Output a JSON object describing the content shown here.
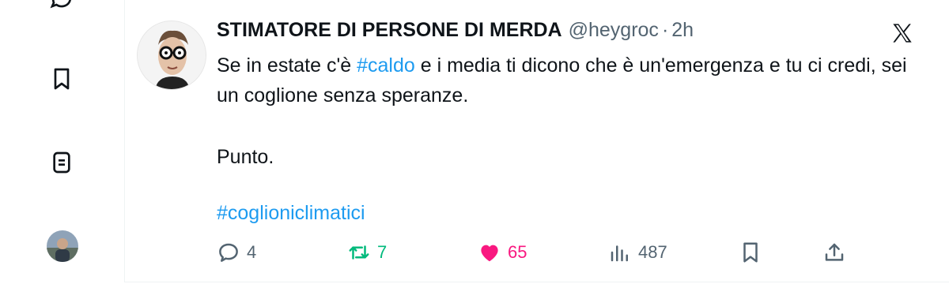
{
  "tweet": {
    "display_name": "STIMATORE DI PERSONE DI MERDA",
    "handle": "@heygroc",
    "separator": "·",
    "time": "2h",
    "text_before": "Se in estate c'è ",
    "hashtag_1": "#caldo",
    "text_after": " e i media ti dicono che è un'emergenza e tu ci credi, sei un coglione senza speranze.",
    "paragraph_2": "Punto.",
    "hashtag_2": "#coglioniclimatici"
  },
  "actions": {
    "replies": "4",
    "retweets": "7",
    "likes": "65",
    "views": "487"
  },
  "colors": {
    "link": "#1d9bf0",
    "retweet": "#00ba7c",
    "like": "#f91880",
    "muted": "#536471"
  },
  "icons": [
    "messages-icon",
    "bookmarks-icon",
    "lists-icon",
    "profile-avatar",
    "x-logo-icon",
    "reply-icon",
    "retweet-icon",
    "like-icon",
    "views-icon",
    "bookmark-icon",
    "share-icon"
  ]
}
